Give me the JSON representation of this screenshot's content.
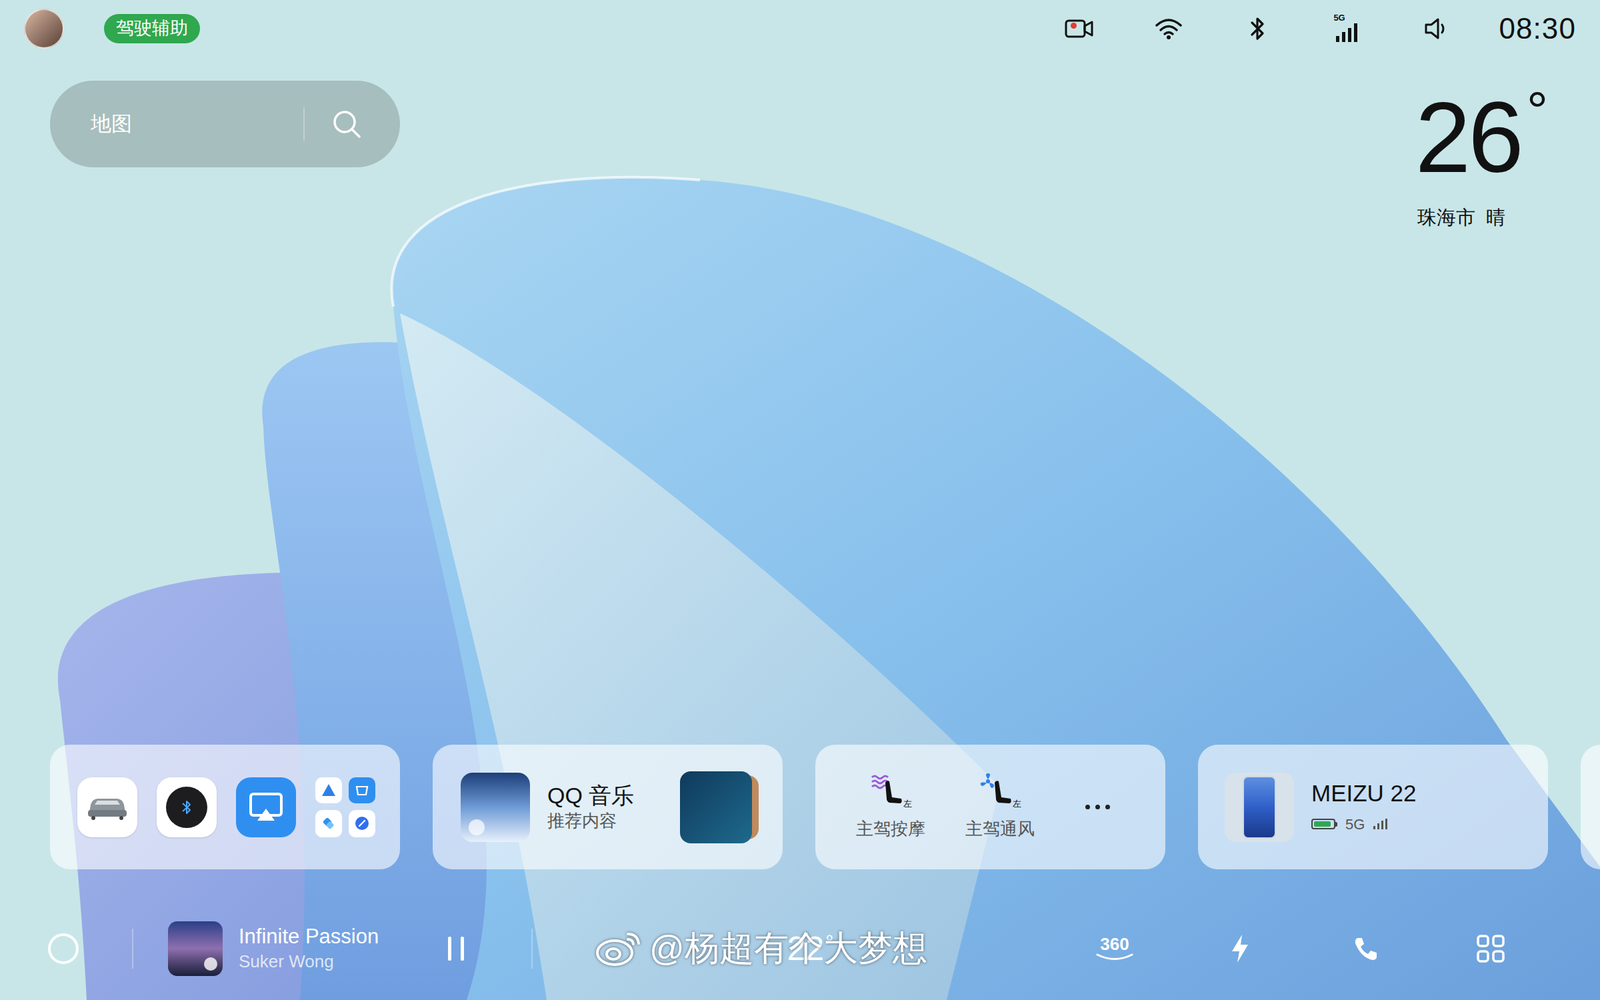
{
  "status_bar": {
    "driver_assist": "驾驶辅助",
    "dashcam_recording": true,
    "network": "5G",
    "time": "08:30"
  },
  "search": {
    "label": "地图"
  },
  "weather": {
    "temperature": "26",
    "unit": "°",
    "city": "珠海市",
    "condition": "晴"
  },
  "cards": {
    "music": {
      "app": "QQ 音乐",
      "subtitle": "推荐内容"
    },
    "seat": {
      "items": [
        {
          "label": "主驾按摩",
          "side": "左",
          "kind": "massage"
        },
        {
          "label": "主驾通风",
          "side": "左",
          "kind": "ventilation"
        }
      ]
    },
    "phone": {
      "name": "MEIZU 22",
      "network": "5G",
      "battery_level": 0.9
    }
  },
  "dock": {
    "now_playing": {
      "title": "Infinite Passion",
      "artist": "Suker Wong",
      "playing": true
    },
    "climate": {
      "temperature": "22",
      "unit": "°"
    },
    "surround_view": "360"
  },
  "watermark": "@杨超有个大梦想"
}
